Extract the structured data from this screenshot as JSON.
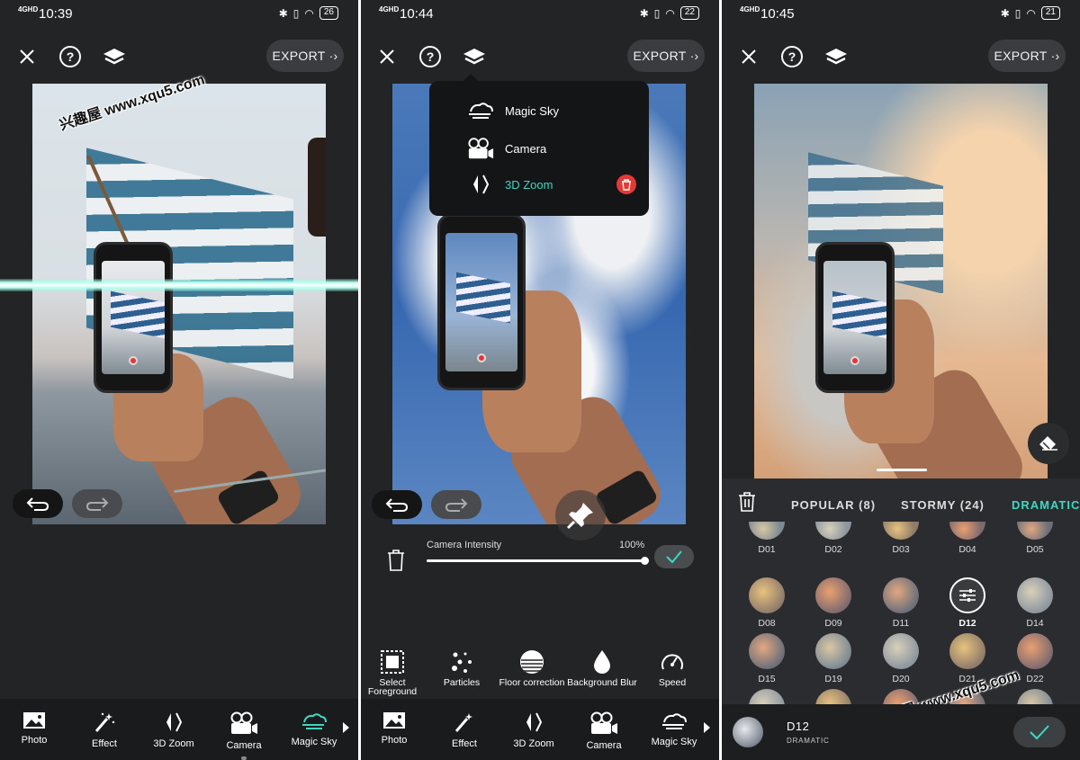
{
  "screens": [
    {
      "status": {
        "network": "4GHD",
        "time": "10:39",
        "battery": "26"
      },
      "export_label": "EXPORT",
      "watermark": "兴趣屋 www.xqu5.com",
      "nav": [
        {
          "label": "Photo",
          "icon": "photo-icon"
        },
        {
          "label": "Effect",
          "icon": "magic-wand-icon"
        },
        {
          "label": "3D Zoom",
          "icon": "3d-zoom-icon"
        },
        {
          "label": "Camera",
          "icon": "camera-icon"
        },
        {
          "label": "Magic Sky",
          "icon": "magic-sky-icon",
          "active": true
        }
      ]
    },
    {
      "status": {
        "network": "4GHD",
        "time": "10:44",
        "battery": "22"
      },
      "export_label": "EXPORT",
      "layer_menu": [
        {
          "label": "Magic Sky",
          "icon": "magic-sky-icon"
        },
        {
          "label": "Camera",
          "icon": "camera-icon"
        },
        {
          "label": "3D Zoom",
          "icon": "3d-zoom-icon",
          "active": true
        }
      ],
      "slider": {
        "label": "Camera Intensity",
        "value": "100%",
        "level": 1.0
      },
      "tools": [
        {
          "label": "Select Foreground",
          "icon": "select-foreground-icon"
        },
        {
          "label": "Particles",
          "icon": "particles-icon"
        },
        {
          "label": "Floor correction",
          "icon": "floor-correction-icon"
        },
        {
          "label": "Background Blur",
          "icon": "background-blur-icon"
        },
        {
          "label": "Speed",
          "icon": "speed-icon"
        }
      ],
      "nav": [
        {
          "label": "Photo",
          "icon": "photo-icon"
        },
        {
          "label": "Effect",
          "icon": "magic-wand-icon"
        },
        {
          "label": "3D Zoom",
          "icon": "3d-zoom-icon"
        },
        {
          "label": "Camera",
          "icon": "camera-icon"
        },
        {
          "label": "Magic Sky",
          "icon": "magic-sky-icon"
        }
      ]
    },
    {
      "status": {
        "network": "4GHD",
        "time": "10:45",
        "battery": "21"
      },
      "export_label": "EXPORT",
      "watermark": "兴趣屋 www.xqu5.com",
      "sky_tabs": [
        {
          "label": "POPULAR (8)"
        },
        {
          "label": "STORMY (24)"
        },
        {
          "label": "DRAMATIC",
          "active": true
        }
      ],
      "skies": [
        "D01",
        "D02",
        "D03",
        "D04",
        "D05",
        "D08",
        "D09",
        "D11",
        "D12",
        "D14",
        "D15",
        "D19",
        "D20",
        "D21",
        "D22",
        "",
        "",
        "",
        "",
        ""
      ],
      "selected_sky": {
        "name": "D12",
        "category": "DRAMATIC"
      }
    }
  ],
  "colors": {
    "accent": "#3ed8c2",
    "panel": "#232426",
    "delete": "#e53935"
  }
}
